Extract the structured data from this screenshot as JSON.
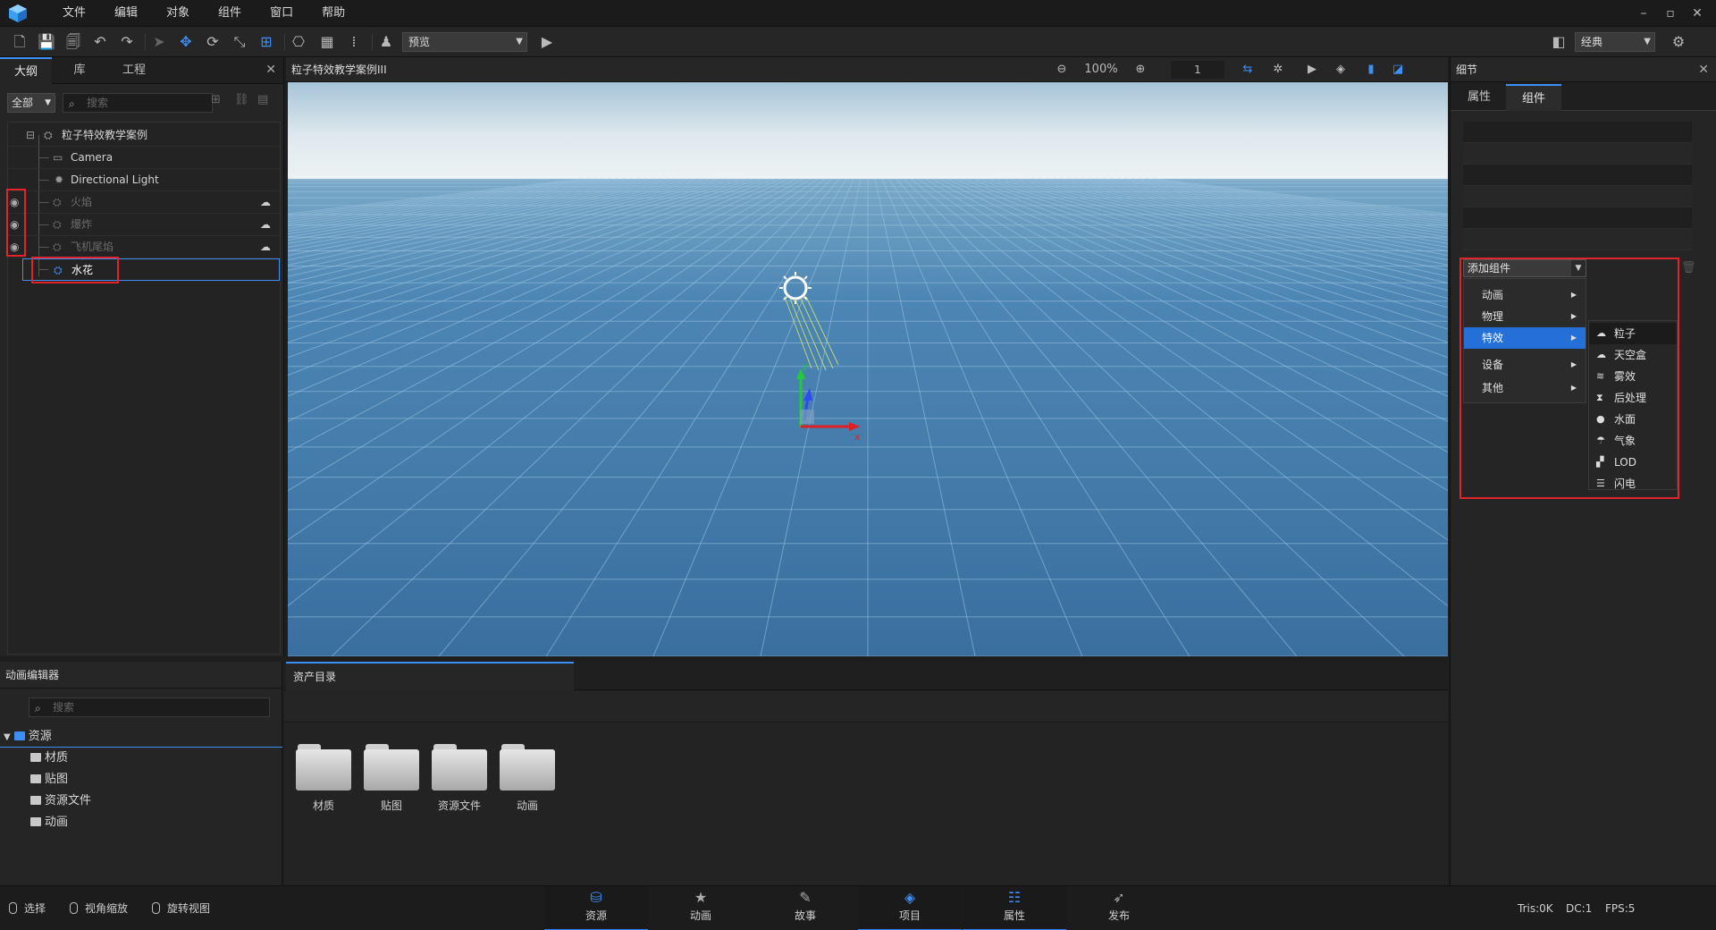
{
  "menubar": {
    "items": [
      "文件",
      "编辑",
      "对象",
      "组件",
      "窗口",
      "帮助"
    ],
    "window_buttons": [
      "–",
      "▫",
      "✕"
    ]
  },
  "toolbar": {
    "mode_select": "预览",
    "layout_select": "经典"
  },
  "outline": {
    "tabs": [
      "大纲",
      "库",
      "工程"
    ],
    "filter": "全部",
    "search_placeholder": "搜索",
    "items": [
      {
        "label": "粒子特效教学案例",
        "icon": "group-icon"
      },
      {
        "label": "Camera",
        "icon": "camera-icon"
      },
      {
        "label": "Directional Light",
        "icon": "light-icon"
      },
      {
        "label": "火焰",
        "icon": "particle-icon",
        "dim": true
      },
      {
        "label": "爆炸",
        "icon": "particle-icon",
        "dim": true
      },
      {
        "label": "飞机尾焰",
        "icon": "particle-icon",
        "dim": true
      },
      {
        "label": "水花",
        "icon": "particle-icon",
        "selected": true
      }
    ]
  },
  "viewport": {
    "title": "粒子特效教学案例III",
    "zoom": "100%",
    "speed": "1",
    "axis_x": "x",
    "axis_y": "y"
  },
  "details": {
    "title": "细节",
    "tabs": [
      "属性",
      "组件"
    ],
    "add_component": "添加组件",
    "menu": [
      "动画",
      "物理",
      "特效",
      "设备",
      "其他"
    ],
    "submenu": [
      {
        "label": "粒子",
        "icon": "particle-icon"
      },
      {
        "label": "天空盒",
        "icon": "cloud-icon"
      },
      {
        "label": "雾效",
        "icon": "fog-icon"
      },
      {
        "label": "后处理",
        "icon": "hourglass-icon"
      },
      {
        "label": "水面",
        "icon": "water-drop-icon"
      },
      {
        "label": "气象",
        "icon": "weather-icon"
      },
      {
        "label": "LOD",
        "icon": "lod-icon"
      },
      {
        "label": "闪电",
        "icon": "layers-icon"
      }
    ]
  },
  "anim_editor": {
    "title": "动画编辑器",
    "search_placeholder": "搜索",
    "root": "资源",
    "children": [
      "材质",
      "贴图",
      "资源文件",
      "动画"
    ]
  },
  "assets": {
    "tab": "资产目录",
    "folders": [
      "材质",
      "贴图",
      "资源文件",
      "动画"
    ]
  },
  "statusbar": {
    "hints": [
      "选择",
      "视角缩放",
      "旋转视图"
    ],
    "tabs": [
      {
        "label": "资源",
        "icon": "assets-icon",
        "active": true
      },
      {
        "label": "动画",
        "icon": "star-icon",
        "active": false
      },
      {
        "label": "故事",
        "icon": "wand-icon",
        "active": false
      },
      {
        "label": "项目",
        "icon": "cube-icon",
        "active": true
      },
      {
        "label": "属性",
        "icon": "sliders-icon",
        "active": true
      },
      {
        "label": "发布",
        "icon": "rocket-icon",
        "active": false
      }
    ],
    "tris": "Tris:0K",
    "dc": "DC:1",
    "fps": "FPS:5"
  },
  "colors": {
    "accent": "#3d8ef5",
    "highlight": "#e0242a",
    "menu_highlight": "#2470d8"
  }
}
